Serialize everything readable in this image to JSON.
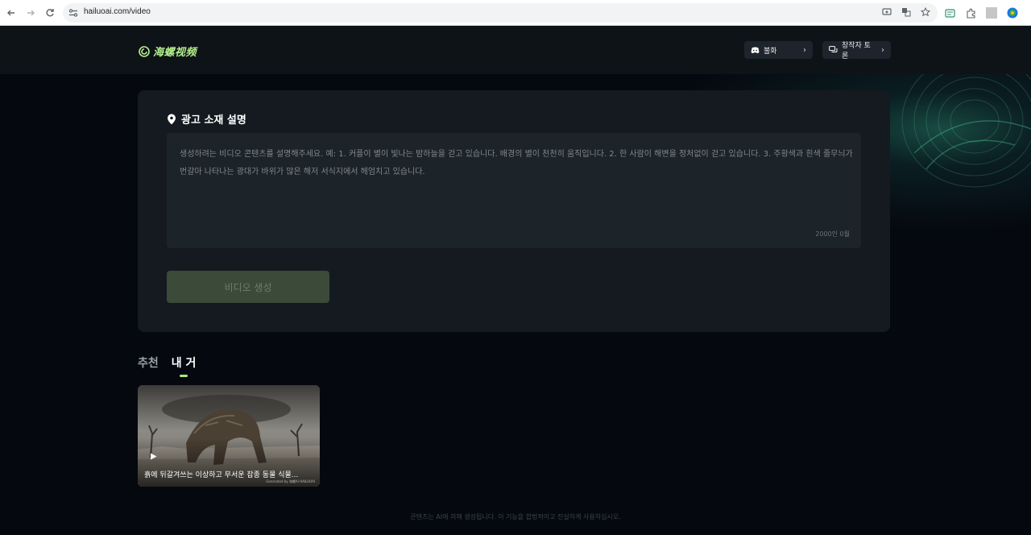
{
  "browser": {
    "url": "hailuoai.com/video",
    "nav": {
      "back_icon": "arrow-left-icon",
      "forward_icon": "arrow-right-icon",
      "reload_icon": "reload-icon"
    }
  },
  "header": {
    "logo_text": "海螺视频",
    "discord_label": "불화",
    "creator_label": "창작자 토론"
  },
  "prompt": {
    "title": "광고 소재 설명",
    "placeholder": "생성하려는 비디오 콘텐츠를 설명해주세요. 예: 1. 커플이 별이 빛나는 밤하늘을 걷고 있습니다. 배경의 별이 천천히 움직입니다. 2. 한 사람이 해변을 정처없이 걷고 있습니다. 3. 주황색과 흰색 줄무늬가 번갈아 나타나는 광대가 바위가 많은 해저 서식지에서 헤엄치고 있습니다.",
    "char_count": "2000인 0뭘",
    "generate_label": "비디오 생성"
  },
  "tabs": [
    {
      "label": "추천",
      "active": false
    },
    {
      "label": "내 거",
      "active": true
    }
  ],
  "videos": [
    {
      "title": "흙에 뒤갈겨쓰는 이상하고 무서운 잡종 동물 식물...",
      "watermark": "Generated by 海螺AI HAILUOAI"
    }
  ],
  "footer": {
    "note": "콘텐츠는 AI에 의해 생성됩니다. 이 기능을 합법적이고 진실하게 사용하십시오."
  },
  "colors": {
    "accent": "#a6ec7a",
    "page_bg": "#05080f",
    "card_bg": "#141a20",
    "input_bg": "#1c2329",
    "button_disabled": "#3b4a39"
  }
}
